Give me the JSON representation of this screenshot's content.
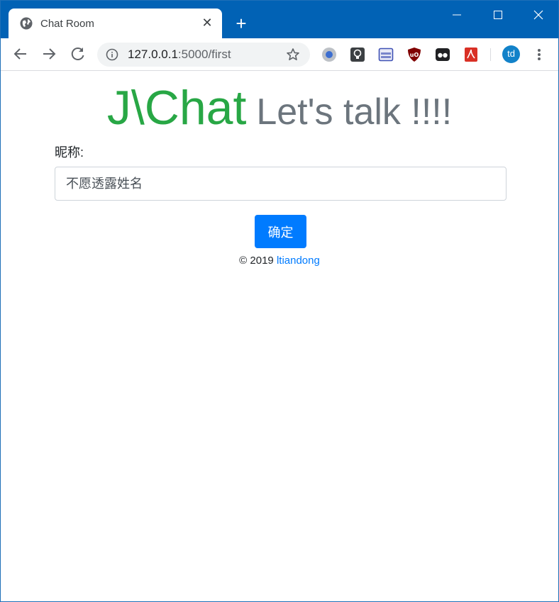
{
  "browser": {
    "tab": {
      "title": "Chat Room",
      "favicon": "globe-icon"
    },
    "new_tab_icon": "plus-icon",
    "window_controls": [
      "minimize-icon",
      "maximize-icon",
      "close-icon"
    ],
    "address": {
      "host": "127.0.0.1",
      "rest": ":5000/first"
    },
    "profile_initials": "td",
    "extensions": [
      "record-extension",
      "lightbulb-extension",
      "window-extension",
      "ublock-extension",
      "eyes-extension",
      "pdf-extension"
    ]
  },
  "page": {
    "brand": "J\\Chat",
    "tagline": "Let's talk !!!!",
    "nickname_label": "昵称:",
    "nickname_placeholder": "不愿透露姓名",
    "submit_label": "确定",
    "footer_prefix": "© 2019",
    "footer_author": "ltiandong"
  },
  "colors": {
    "titlebar": "#0162b5",
    "brand": "#28a745",
    "tagline": "#6c757d",
    "primary": "#007bff"
  }
}
